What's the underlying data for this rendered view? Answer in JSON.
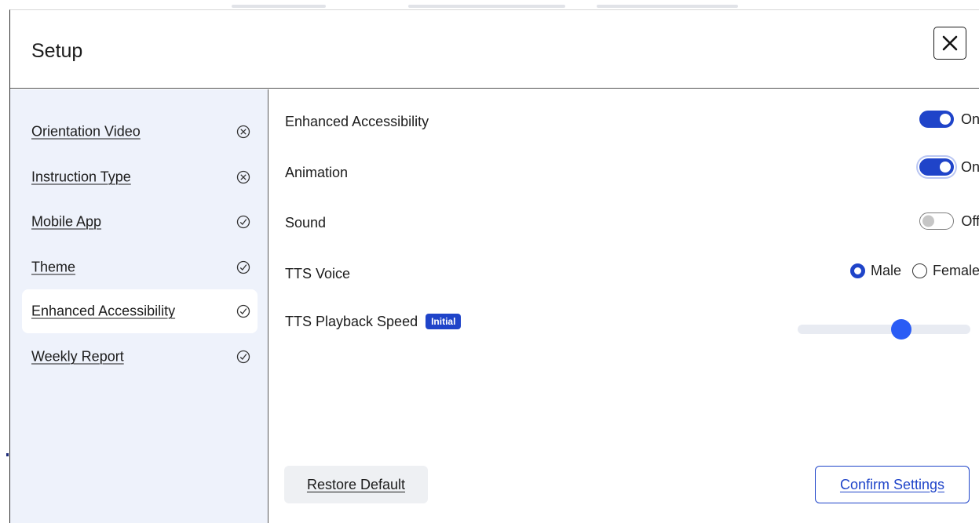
{
  "dialog": {
    "title": "Setup",
    "close_icon": "close-icon"
  },
  "sidebar": {
    "items": [
      {
        "label": "Orientation Video",
        "status": "incomplete",
        "status_icon": "circle-x-icon",
        "active": false
      },
      {
        "label": "Instruction Type",
        "status": "incomplete",
        "status_icon": "circle-x-icon",
        "active": false
      },
      {
        "label": "Mobile App",
        "status": "complete",
        "status_icon": "circle-check-icon",
        "active": false
      },
      {
        "label": "Theme",
        "status": "complete",
        "status_icon": "circle-check-icon",
        "active": false
      },
      {
        "label": "Enhanced Accessibility",
        "status": "complete",
        "status_icon": "circle-check-icon",
        "active": true
      },
      {
        "label": "Weekly Report",
        "status": "complete",
        "status_icon": "circle-check-icon",
        "active": false
      }
    ]
  },
  "settings": {
    "enhanced_accessibility": {
      "label": "Enhanced Accessibility",
      "state": "On",
      "on": true
    },
    "animation": {
      "label": "Animation",
      "state": "On",
      "on": true
    },
    "sound": {
      "label": "Sound",
      "state": "Off",
      "on": false
    },
    "tts_voice": {
      "label": "TTS Voice",
      "options": [
        {
          "label": "Male",
          "selected": true
        },
        {
          "label": "Female",
          "selected": false
        }
      ]
    },
    "tts_playback_speed": {
      "label": "TTS Playback Speed",
      "badge": "Initial",
      "level": 0.6
    }
  },
  "footer": {
    "restore_label": "Restore Default",
    "confirm_label": "Confirm Settings"
  },
  "colors": {
    "accent": "#1f44c9",
    "sidebar_bg": "#eef2fb",
    "slider_thumb": "#2a5cf5"
  }
}
